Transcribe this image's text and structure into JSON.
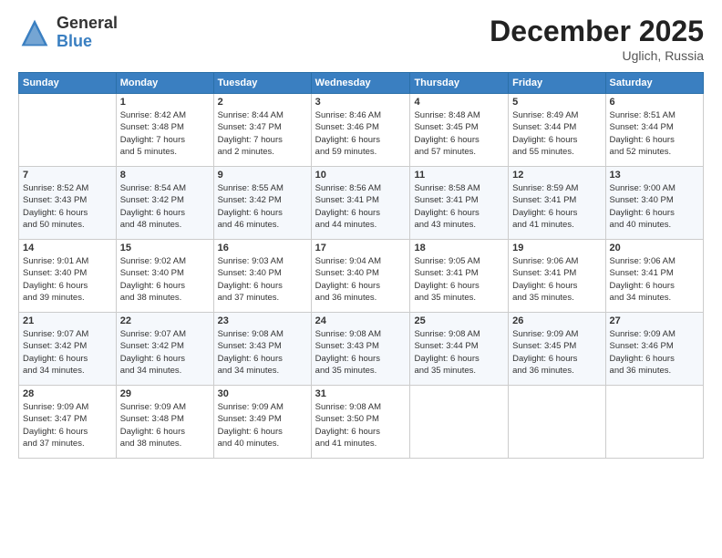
{
  "logo": {
    "general": "General",
    "blue": "Blue"
  },
  "title": {
    "month": "December 2025",
    "location": "Uglich, Russia"
  },
  "days_of_week": [
    "Sunday",
    "Monday",
    "Tuesday",
    "Wednesday",
    "Thursday",
    "Friday",
    "Saturday"
  ],
  "weeks": [
    [
      {
        "day": "",
        "info": ""
      },
      {
        "day": "1",
        "info": "Sunrise: 8:42 AM\nSunset: 3:48 PM\nDaylight: 7 hours\nand 5 minutes."
      },
      {
        "day": "2",
        "info": "Sunrise: 8:44 AM\nSunset: 3:47 PM\nDaylight: 7 hours\nand 2 minutes."
      },
      {
        "day": "3",
        "info": "Sunrise: 8:46 AM\nSunset: 3:46 PM\nDaylight: 6 hours\nand 59 minutes."
      },
      {
        "day": "4",
        "info": "Sunrise: 8:48 AM\nSunset: 3:45 PM\nDaylight: 6 hours\nand 57 minutes."
      },
      {
        "day": "5",
        "info": "Sunrise: 8:49 AM\nSunset: 3:44 PM\nDaylight: 6 hours\nand 55 minutes."
      },
      {
        "day": "6",
        "info": "Sunrise: 8:51 AM\nSunset: 3:44 PM\nDaylight: 6 hours\nand 52 minutes."
      }
    ],
    [
      {
        "day": "7",
        "info": "Sunrise: 8:52 AM\nSunset: 3:43 PM\nDaylight: 6 hours\nand 50 minutes."
      },
      {
        "day": "8",
        "info": "Sunrise: 8:54 AM\nSunset: 3:42 PM\nDaylight: 6 hours\nand 48 minutes."
      },
      {
        "day": "9",
        "info": "Sunrise: 8:55 AM\nSunset: 3:42 PM\nDaylight: 6 hours\nand 46 minutes."
      },
      {
        "day": "10",
        "info": "Sunrise: 8:56 AM\nSunset: 3:41 PM\nDaylight: 6 hours\nand 44 minutes."
      },
      {
        "day": "11",
        "info": "Sunrise: 8:58 AM\nSunset: 3:41 PM\nDaylight: 6 hours\nand 43 minutes."
      },
      {
        "day": "12",
        "info": "Sunrise: 8:59 AM\nSunset: 3:41 PM\nDaylight: 6 hours\nand 41 minutes."
      },
      {
        "day": "13",
        "info": "Sunrise: 9:00 AM\nSunset: 3:40 PM\nDaylight: 6 hours\nand 40 minutes."
      }
    ],
    [
      {
        "day": "14",
        "info": "Sunrise: 9:01 AM\nSunset: 3:40 PM\nDaylight: 6 hours\nand 39 minutes."
      },
      {
        "day": "15",
        "info": "Sunrise: 9:02 AM\nSunset: 3:40 PM\nDaylight: 6 hours\nand 38 minutes."
      },
      {
        "day": "16",
        "info": "Sunrise: 9:03 AM\nSunset: 3:40 PM\nDaylight: 6 hours\nand 37 minutes."
      },
      {
        "day": "17",
        "info": "Sunrise: 9:04 AM\nSunset: 3:40 PM\nDaylight: 6 hours\nand 36 minutes."
      },
      {
        "day": "18",
        "info": "Sunrise: 9:05 AM\nSunset: 3:41 PM\nDaylight: 6 hours\nand 35 minutes."
      },
      {
        "day": "19",
        "info": "Sunrise: 9:06 AM\nSunset: 3:41 PM\nDaylight: 6 hours\nand 35 minutes."
      },
      {
        "day": "20",
        "info": "Sunrise: 9:06 AM\nSunset: 3:41 PM\nDaylight: 6 hours\nand 34 minutes."
      }
    ],
    [
      {
        "day": "21",
        "info": "Sunrise: 9:07 AM\nSunset: 3:42 PM\nDaylight: 6 hours\nand 34 minutes."
      },
      {
        "day": "22",
        "info": "Sunrise: 9:07 AM\nSunset: 3:42 PM\nDaylight: 6 hours\nand 34 minutes."
      },
      {
        "day": "23",
        "info": "Sunrise: 9:08 AM\nSunset: 3:43 PM\nDaylight: 6 hours\nand 34 minutes."
      },
      {
        "day": "24",
        "info": "Sunrise: 9:08 AM\nSunset: 3:43 PM\nDaylight: 6 hours\nand 35 minutes."
      },
      {
        "day": "25",
        "info": "Sunrise: 9:08 AM\nSunset: 3:44 PM\nDaylight: 6 hours\nand 35 minutes."
      },
      {
        "day": "26",
        "info": "Sunrise: 9:09 AM\nSunset: 3:45 PM\nDaylight: 6 hours\nand 36 minutes."
      },
      {
        "day": "27",
        "info": "Sunrise: 9:09 AM\nSunset: 3:46 PM\nDaylight: 6 hours\nand 36 minutes."
      }
    ],
    [
      {
        "day": "28",
        "info": "Sunrise: 9:09 AM\nSunset: 3:47 PM\nDaylight: 6 hours\nand 37 minutes."
      },
      {
        "day": "29",
        "info": "Sunrise: 9:09 AM\nSunset: 3:48 PM\nDaylight: 6 hours\nand 38 minutes."
      },
      {
        "day": "30",
        "info": "Sunrise: 9:09 AM\nSunset: 3:49 PM\nDaylight: 6 hours\nand 40 minutes."
      },
      {
        "day": "31",
        "info": "Sunrise: 9:08 AM\nSunset: 3:50 PM\nDaylight: 6 hours\nand 41 minutes."
      },
      {
        "day": "",
        "info": ""
      },
      {
        "day": "",
        "info": ""
      },
      {
        "day": "",
        "info": ""
      }
    ]
  ]
}
